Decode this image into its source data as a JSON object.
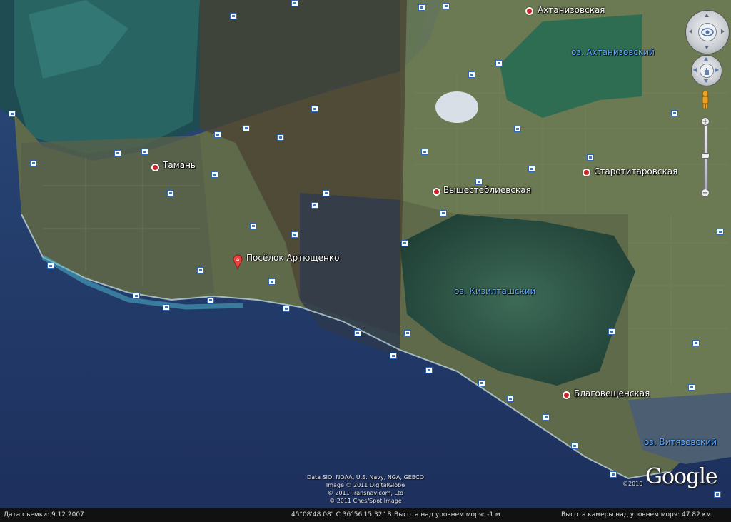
{
  "settlements": [
    {
      "name": "Ахтанизовская"
    },
    {
      "name": "Тамань"
    },
    {
      "name": "Старотитаровская"
    },
    {
      "name": "Вышестеблиевская"
    },
    {
      "name": "Благовещенская"
    }
  ],
  "highlight_place": {
    "name": "Посёлок Артющенко",
    "pin_letter": "A"
  },
  "water_bodies": [
    {
      "name": "оз. Ахтанизовский"
    },
    {
      "name": "оз. Кизилташский"
    },
    {
      "name": "оз. Витязевский"
    }
  ],
  "attribution": {
    "lines": [
      "Data SIO, NOAA, U.S. Navy, NGA, GEBCO",
      "Image © 2011 DigitalGlobe",
      "© 2011 Transnavicom, Ltd",
      "© 2011 Cnes/Spot Image"
    ],
    "copyright_year": "©2010",
    "logo": "Google"
  },
  "status_bar": {
    "image_date": "Дата съемки: 9.12.2007",
    "coordinates": "45°08'48.08\" С  36°56'15.32\" В",
    "elevation": "Высота над уровнем моря:   -1 м",
    "eye_altitude": "Высота камеры над уровнем моря:   47.82 км"
  },
  "controls": {
    "zoom_in": "+",
    "zoom_out": "−",
    "pegman_icon": "pegman-icon",
    "compass_north": "N"
  }
}
